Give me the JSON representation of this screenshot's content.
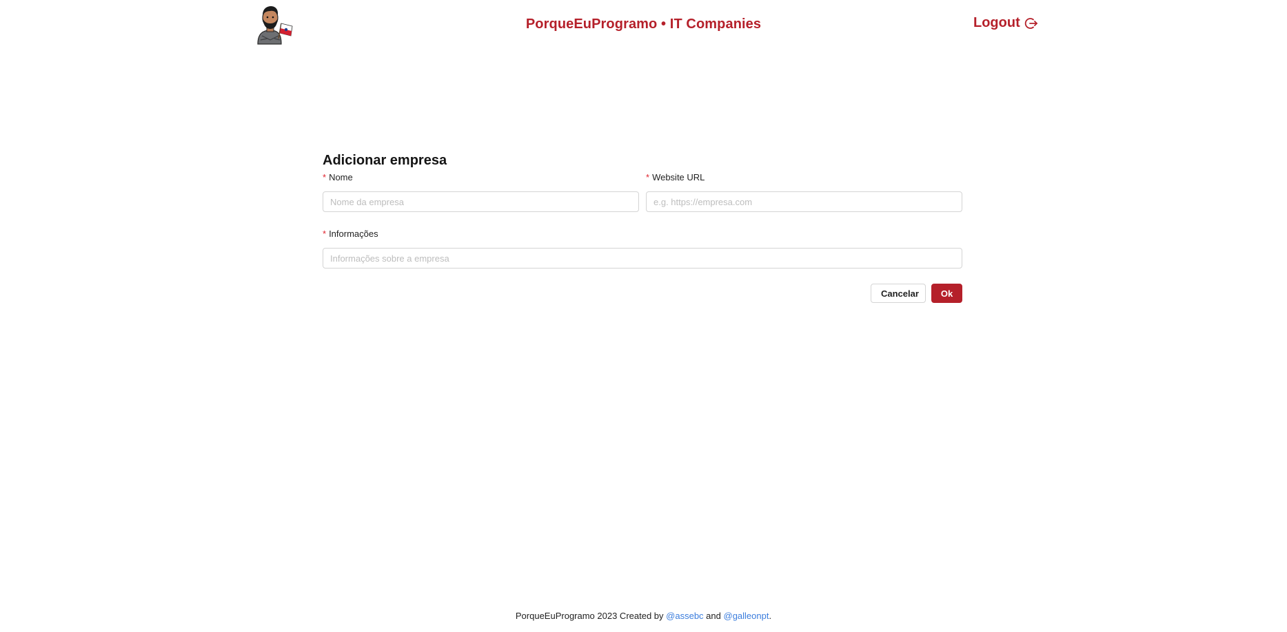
{
  "header": {
    "title": "PorqueEuProgramo • IT Companies",
    "logout_label": "Logout",
    "accent_color": "#b5202a",
    "logo_icon": "bearded-man-avatar-with-flag",
    "logout_icon": "logout-arrow-icon"
  },
  "form": {
    "title": "Adicionar empresa",
    "required_marker": "*",
    "fields": {
      "name": {
        "label": "Nome",
        "placeholder": "Nome da empresa",
        "value": ""
      },
      "website": {
        "label": "Website URL",
        "placeholder": "e.g. https://empresa.com",
        "value": ""
      },
      "info": {
        "label": "Informações",
        "placeholder": "Informações sobre a empresa",
        "value": ""
      }
    },
    "cancel_label": "Cancelar",
    "ok_label": "Ok"
  },
  "footer": {
    "prefix": "PorqueEuProgramo 2023 Created by",
    "author1": "@assebc",
    "connector": "and",
    "author2": "@galleonpt",
    "suffix": ".",
    "link_color": "#3b7ddd"
  }
}
